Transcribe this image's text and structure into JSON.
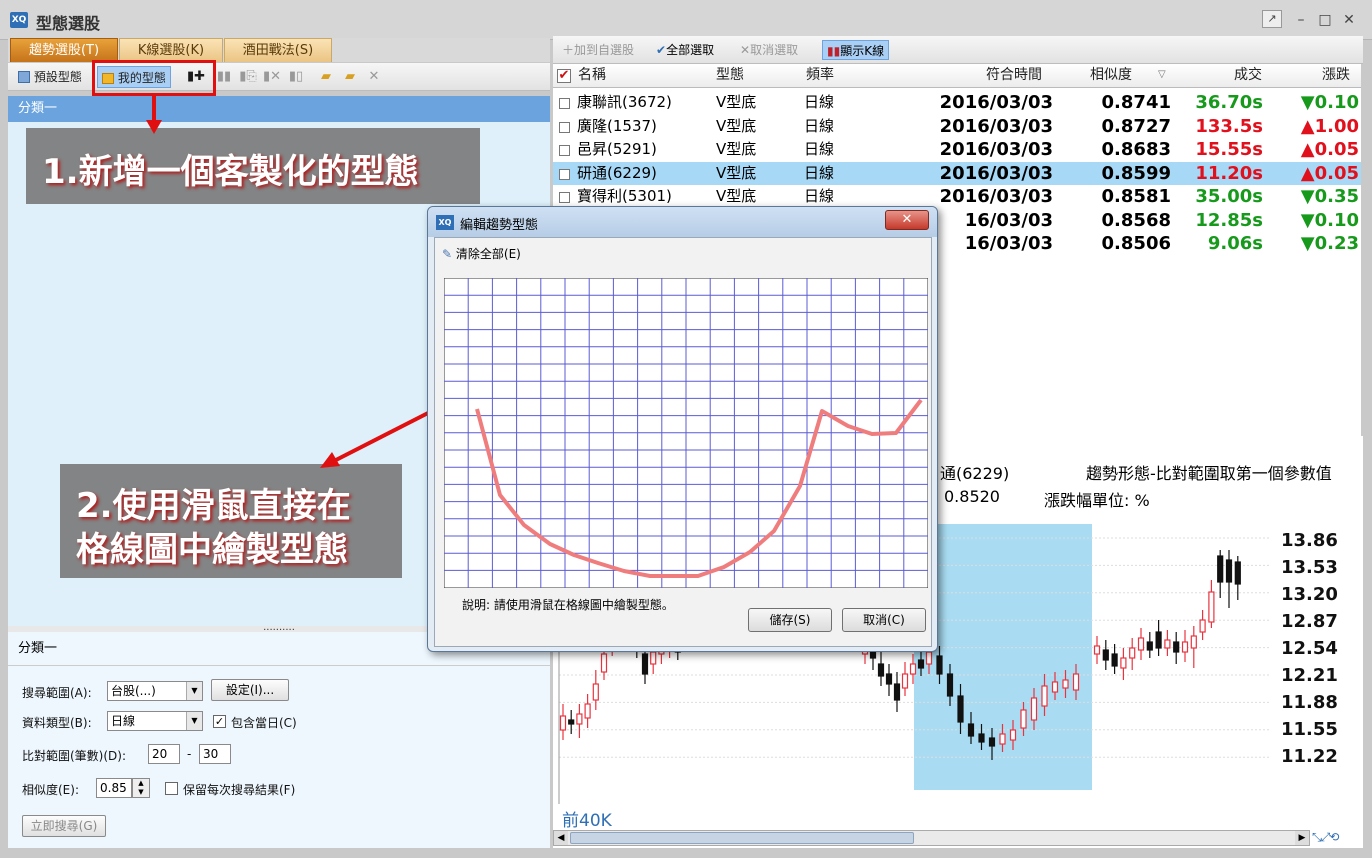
{
  "window": {
    "title": "型態選股",
    "app_icon_text": "XQ",
    "help_icon": "help-icon",
    "minimize": "–",
    "maximize": "□",
    "close": "✕"
  },
  "left_tabs": [
    "趨勢選股(T)",
    "K線選股(K)",
    "酒田戰法(S)"
  ],
  "left_toolbar": {
    "preset_label": "預設型態",
    "mine_label": "我的型態"
  },
  "category_header": "分類一",
  "splitter_dots": "..........",
  "category2_header": "分類一",
  "form": {
    "search_range_label": "搜尋範圍(A):",
    "search_range_value": "台股(...)",
    "settings_button": "設定(I)...",
    "data_type_label": "資料類型(B):",
    "data_type_value": "日線",
    "include_today_label": "包含當日(C)",
    "include_today_checked": true,
    "compare_range_label": "比對範圍(筆數)(D):",
    "compare_from": "20",
    "dash": "-",
    "compare_to": "30",
    "similarity_label": "相似度(E):",
    "similarity_value": "0.85",
    "keep_results_label": "保留每次搜尋結果(F)",
    "keep_results_checked": false,
    "search_now_button": "立即搜尋(G)"
  },
  "annotations": {
    "step1": "1.新增一個客製化的型態",
    "step2_line1": "2.使用滑鼠直接在",
    "step2_line2": "格線圖中繪製型態"
  },
  "right_toolbar": {
    "add_watch": "加到自選股",
    "select_all": "全部選取",
    "deselect": "取消選取",
    "show_k": "顯示K線"
  },
  "table": {
    "headers": [
      "名稱",
      "型態",
      "頻率",
      "符合時間",
      "相似度",
      "成交",
      "漲跌"
    ],
    "sort_indicator": "▽",
    "rows": [
      {
        "name": "康聯訊(3672)",
        "type": "V型底",
        "freq": "日線",
        "time": "2016/03/03",
        "sim": "0.8741",
        "price": "36.70s",
        "chg": "▼0.10",
        "dir": "dn",
        "selected": false
      },
      {
        "name": "廣隆(1537)",
        "type": "V型底",
        "freq": "日線",
        "time": "2016/03/03",
        "sim": "0.8727",
        "price": "133.5s",
        "chg": "▲1.00",
        "dir": "up",
        "selected": false
      },
      {
        "name": "邑昇(5291)",
        "type": "V型底",
        "freq": "日線",
        "time": "2016/03/03",
        "sim": "0.8683",
        "price": "15.55s",
        "chg": "▲0.05",
        "dir": "up",
        "selected": false
      },
      {
        "name": "研通(6229)",
        "type": "V型底",
        "freq": "日線",
        "time": "2016/03/03",
        "sim": "0.8599",
        "price": "11.20s",
        "chg": "▲0.05",
        "dir": "up",
        "selected": true
      },
      {
        "name": "寶得利(5301)",
        "type": "V型底",
        "freq": "日線",
        "time": "2016/03/03",
        "sim": "0.8581",
        "price": "35.00s",
        "chg": "▼0.35",
        "dir": "dn",
        "selected": false
      },
      {
        "name": "",
        "type": "",
        "freq": "",
        "time": "16/03/03",
        "sim": "0.8568",
        "price": "12.85s",
        "chg": "▼0.10",
        "dir": "dn",
        "selected": false
      },
      {
        "name": "",
        "type": "",
        "freq": "",
        "time": "16/03/03",
        "sim": "0.8506",
        "price": "9.06s",
        "chg": "▼0.23",
        "dir": "dn",
        "selected": false
      }
    ]
  },
  "chart": {
    "stock_partial": "通(6229)",
    "title_right": "趨勢形態-比對範圍取第一個參數值",
    "sim_partial": "0.8520",
    "unit_label": "漲跌幅單位: %",
    "y_ticks": [
      "13.86",
      "13.53",
      "13.20",
      "12.87",
      "12.54",
      "12.21",
      "11.88",
      "11.55",
      "11.22"
    ],
    "prev_label": "前40K",
    "colors": {
      "up": "#e8343f",
      "down": "#111111",
      "highlight": "#a9dcf3"
    }
  },
  "dialog": {
    "title": "編輯趨勢型態",
    "clear_all": "清除全部(E)",
    "description": "說明: 請使用滑鼠在格線圖中繪製型態。",
    "save_button": "儲存(S)",
    "cancel_button": "取消(C)",
    "close": "✕"
  }
}
